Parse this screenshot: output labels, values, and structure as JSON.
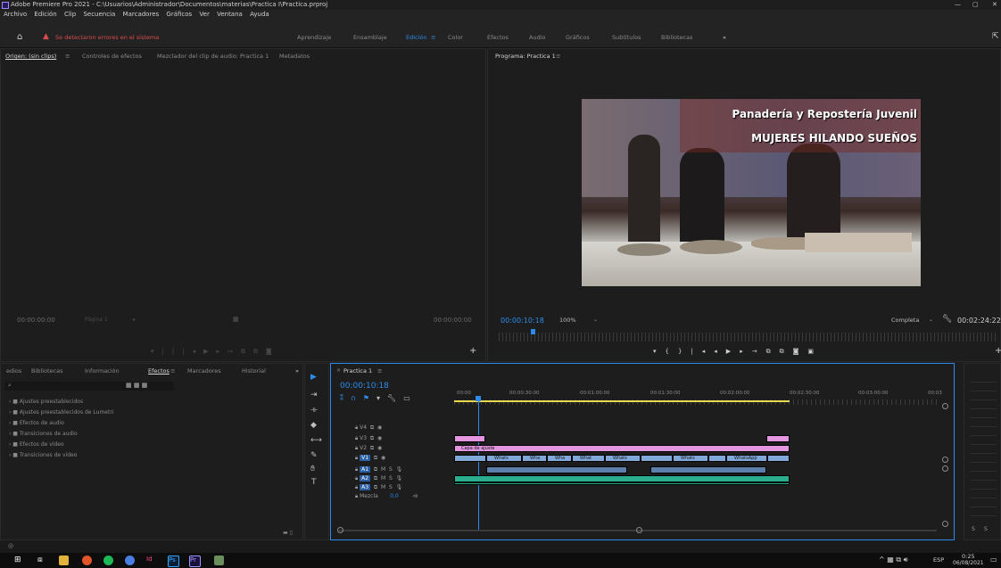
{
  "title_bar": {
    "text": "Adobe Premiere Pro 2021 - C:\\Usuarios\\Administrador\\Documentos\\materias\\Practica I\\Practica.prproj"
  },
  "menu": [
    "Archivo",
    "Edición",
    "Clip",
    "Secuencia",
    "Marcadores",
    "Gráficos",
    "Ver",
    "Ventana",
    "Ayuda"
  ],
  "workspace": {
    "error_text": "Se detectaron errores en el sistema",
    "tabs": [
      "Aprendizaje",
      "Ensamblaje",
      "Edición",
      "Color",
      "Efectos",
      "Audio",
      "Gráficos",
      "Subtítulos",
      "Bibliotecas"
    ],
    "active": "Edición",
    "more": "»"
  },
  "source_panel": {
    "tabs": [
      "Origen: (sin clips)",
      "Controles de efectos",
      "Mezclador del clip de audio: Practica 1",
      "Metadatos"
    ],
    "timecode_left": "00:00:00:00",
    "page_label": "Página 1",
    "timecode_right": "00:00:00:00"
  },
  "program_panel": {
    "title": "Programa: Practica 1",
    "timecode": "00:00:10:18",
    "zoom": "100%",
    "quality": "Completa",
    "duration": "00:02:24:22",
    "overlay_line1": "Panadería y Repostería Juvenil",
    "overlay_line2": "MUJERES HILANDO SUEÑOS"
  },
  "effects_panel": {
    "tabs": [
      "edios",
      "Bibliotecas",
      "Información",
      "Efectos",
      "Marcadores",
      "Historial"
    ],
    "active": "Efectos",
    "tree": [
      "Ajustes preestablecidos",
      "Ajustes preestablecidos de Lumetri",
      "Efectos de audio",
      "Transiciones de audio",
      "Efectos de vídeo",
      "Transiciones de vídeo"
    ]
  },
  "timeline": {
    "sequence": "Practica 1",
    "timecode": "00:00:10:18",
    "ruler": [
      "00:00",
      "00:00:30:00",
      "00:01:00:00",
      "00:01:30:00",
      "00:02:00:00",
      "00:02:30:00",
      "00:03:00:00",
      "00:03"
    ],
    "video_tracks": [
      "V4",
      "V3",
      "V2",
      "V1"
    ],
    "audio_tracks": [
      "A1",
      "A2",
      "A3"
    ],
    "mix_label": "Mezcla",
    "mix_value": "0,0",
    "adjustment_clip": "Capa de ajuste",
    "v1_clips": [
      "Whats",
      "Wha",
      "Wha",
      "What",
      "Whats",
      "Whats",
      "WhatsApp"
    ]
  },
  "audio_meter": {
    "labels": [
      "S",
      "S"
    ]
  },
  "taskbar": {
    "language": "ESP",
    "time": "0:25",
    "date": "06/08/2021"
  },
  "colors": {
    "accent": "#2d8ceb",
    "v_clip": "#7fa8d8",
    "a_clip": "#2bae8f",
    "adj_clip": "#e395e0",
    "error": "#d94b4b"
  }
}
